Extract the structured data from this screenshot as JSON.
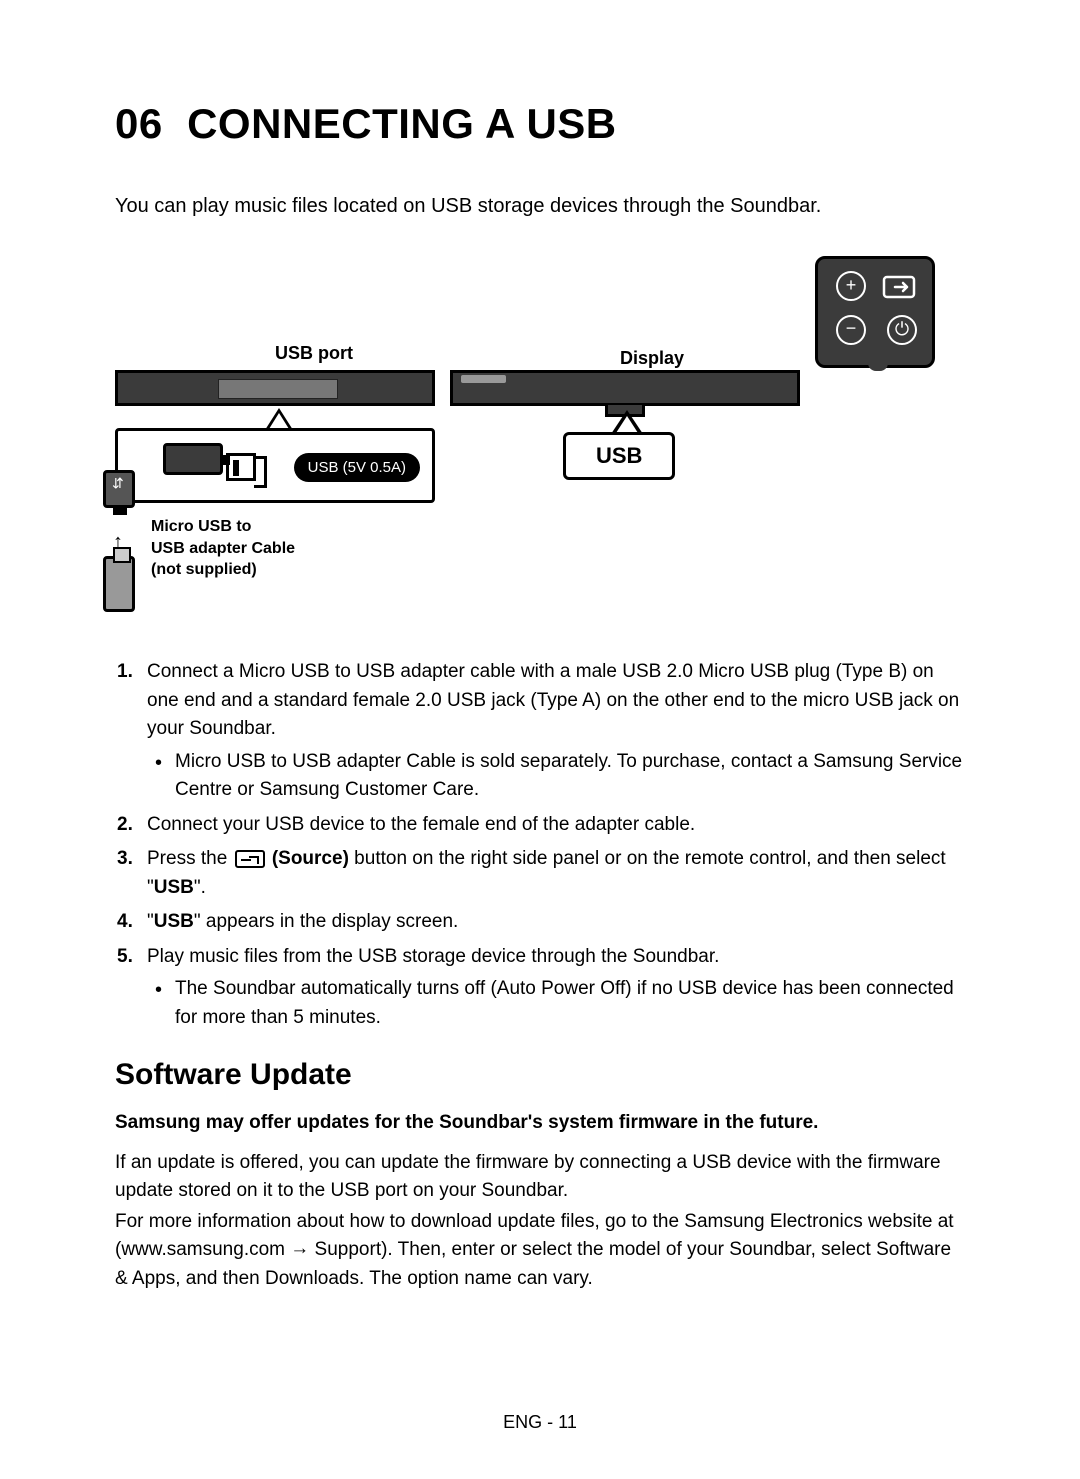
{
  "section": {
    "number": "06",
    "title": "CONNECTING A USB"
  },
  "intro": "You can play music files located on USB storage devices through the Soundbar.",
  "diagram": {
    "usb_port_label": "USB port",
    "display_label": "Display",
    "port_pill": "USB (5V 0.5A)",
    "micro_label_line1": "Micro USB to",
    "micro_label_line2": "USB adapter Cable",
    "micro_label_line3": "(not supplied)",
    "usb_badge": "USB",
    "remote_plus": "+",
    "remote_minus": "−",
    "remote_power": "⏻"
  },
  "steps": {
    "s1": "Connect a Micro USB to USB adapter cable with a male USB 2.0 Micro USB plug (Type B) on one end and a standard female 2.0 USB jack (Type A) on the other end to the micro USB jack on your Soundbar.",
    "s1_bullet": "Micro USB to USB adapter Cable is sold separately. To purchase, contact a Samsung Service Centre or Samsung Customer Care.",
    "s2": "Connect your USB device to the female end of the adapter cable.",
    "s3_a": "Press the ",
    "s3_source": " (Source)",
    "s3_b": " button on the right side panel or on the remote control, and then select \"",
    "s3_usb": "USB",
    "s3_c": "\".",
    "s4_a": "\"",
    "s4_usb": "USB",
    "s4_b": "\" appears in the display screen.",
    "s5": "Play music files from the USB storage device through the Soundbar.",
    "s5_bullet": "The Soundbar automatically turns off (Auto Power Off) if no USB device has been connected for more than 5 minutes."
  },
  "software_update": {
    "heading": "Software Update",
    "note": "Samsung may offer updates for the Soundbar's system firmware in the future.",
    "p1": "If an update is offered, you can update the firmware by connecting a USB device with the firmware update stored on it to the USB port on your Soundbar.",
    "p2a": "For more information about how to download update files, go to the Samsung Electronics website at (www.samsung.com ",
    "arrow": "→",
    "p2b": " Support). Then, enter or select the model of your Soundbar, select Software & Apps, and then Downloads. The option name can vary."
  },
  "page_number": "ENG - 11"
}
